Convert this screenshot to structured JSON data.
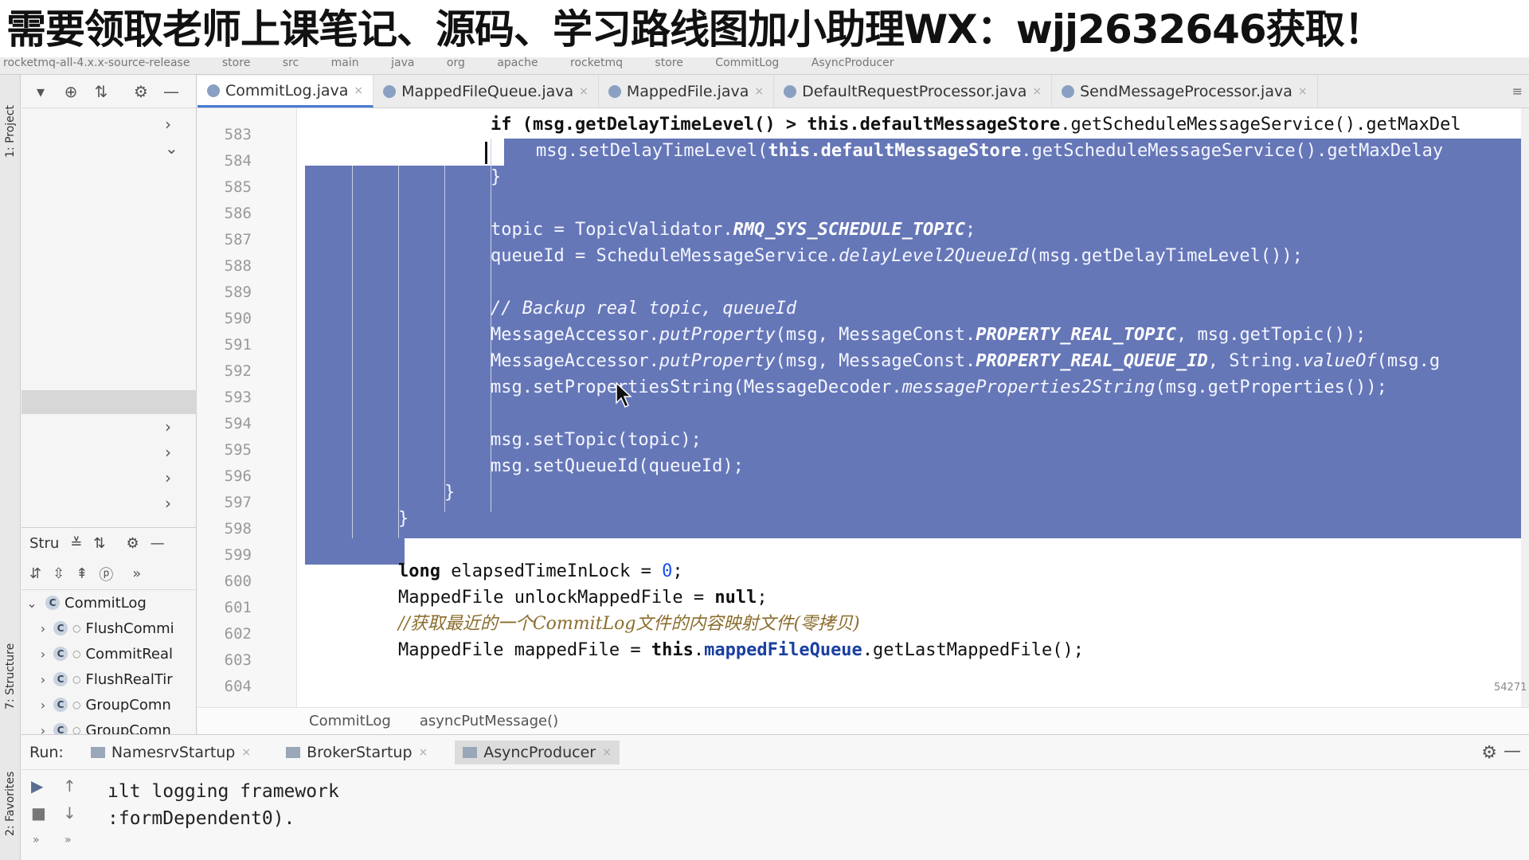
{
  "banner": {
    "text": "需要领取老师上课笔记、源码、学习路线图加小助理WX：wjj2632646获取！"
  },
  "breadcrumb_strip": [
    "rocketmq-all-4.x.x-source-release",
    "store",
    "src",
    "main",
    "java",
    "org",
    "apache",
    "rocketmq",
    "store",
    "CommitLog",
    "AsyncProducer"
  ],
  "tool_stripe": {
    "project_label": "1: Project",
    "structure_label": "7: Structure",
    "favorites_label": "2: Favorites"
  },
  "structure": {
    "title": "Stru",
    "root": "CommitLog",
    "items": [
      "FlushCommi",
      "CommitReal",
      "FlushRealTir",
      "GroupComn",
      "GroupComn"
    ]
  },
  "tabs": [
    {
      "label": "CommitLog.java",
      "active": true
    },
    {
      "label": "MappedFileQueue.java",
      "active": false
    },
    {
      "label": "MappedFile.java",
      "active": false
    },
    {
      "label": "DefaultRequestProcessor.java",
      "active": false
    },
    {
      "label": "SendMessageProcessor.java",
      "active": false
    }
  ],
  "editor": {
    "line_numbers": [
      "583",
      "584",
      "585",
      "586",
      "587",
      "588",
      "589",
      "590",
      "591",
      "592",
      "593",
      "594",
      "595",
      "596",
      "597",
      "598",
      "599",
      "600",
      "601",
      "602",
      "603",
      "604"
    ],
    "lines": {
      "l583a": "if (msg.getDelayTimeLevel() > ",
      "l583b": "this.defaultMessageStore",
      "l583c": ".getScheduleMessageService().getMaxDel",
      "l584a": "msg.setDelayTimeLevel(",
      "l584b": "this.defaultMessageStore",
      "l584c": ".getScheduleMessageService().getMaxDelay",
      "l585": "}",
      "l587a": "topic = TopicValidator.",
      "l587b": "RMQ_SYS_SCHEDULE_TOPIC",
      "l587c": ";",
      "l588a": "queueId = ScheduleMessageService.",
      "l588b": "delayLevel2QueueId",
      "l588c": "(msg.getDelayTimeLevel());",
      "l590": "// Backup real topic, queueId",
      "l591a": "MessageAccessor.",
      "l591b": "putProperty",
      "l591c": "(msg, MessageConst.",
      "l591d": "PROPERTY_REAL_TOPIC",
      "l591e": ", msg.getTopic());",
      "l592a": "MessageAccessor.",
      "l592b": "putProperty",
      "l592c": "(msg, MessageConst.",
      "l592d": "PROPERTY_REAL_QUEUE_ID",
      "l592e": ", String.",
      "l592f": "valueOf",
      "l592g": "(msg.g",
      "l593a": "msg.setPropertiesString(MessageDecoder.",
      "l593b": "messageProperties2String",
      "l593c": "(msg.getProperties());",
      "l595": "msg.setTopic(topic);",
      "l596": "msg.setQueueId(queueId);",
      "l597": "}",
      "l598": "}",
      "l600a": "long",
      "l600b": " elapsedTimeInLock = ",
      "l600c": "0",
      "l600d": ";",
      "l601a": "MappedFile unlockMappedFile = ",
      "l601b": "null",
      "l601c": ";",
      "l602": "//获取最近的一个CommitLog文件的内容映射文件(零拷贝)",
      "l603a": "MappedFile mappedFile = ",
      "l603b": "this",
      "l603c": ".",
      "l603d": "mappedFileQueue",
      "l603e": ".getLastMappedFile();"
    },
    "zoom_badge": "54271"
  },
  "editor_breadcrumb": {
    "class_name": "CommitLog",
    "method_name": "asyncPutMessage()"
  },
  "run": {
    "label": "Run:",
    "tabs": [
      {
        "label": "NamesrvStartup",
        "active": false
      },
      {
        "label": "BrokerStartup",
        "active": false
      },
      {
        "label": "AsyncProducer",
        "active": true
      }
    ],
    "console_lines": [
      "ılt logging framework",
      ":formDependent0)."
    ]
  },
  "colors": {
    "selection": "#6677b8",
    "active_tab_underline": "#4a7bd2"
  }
}
